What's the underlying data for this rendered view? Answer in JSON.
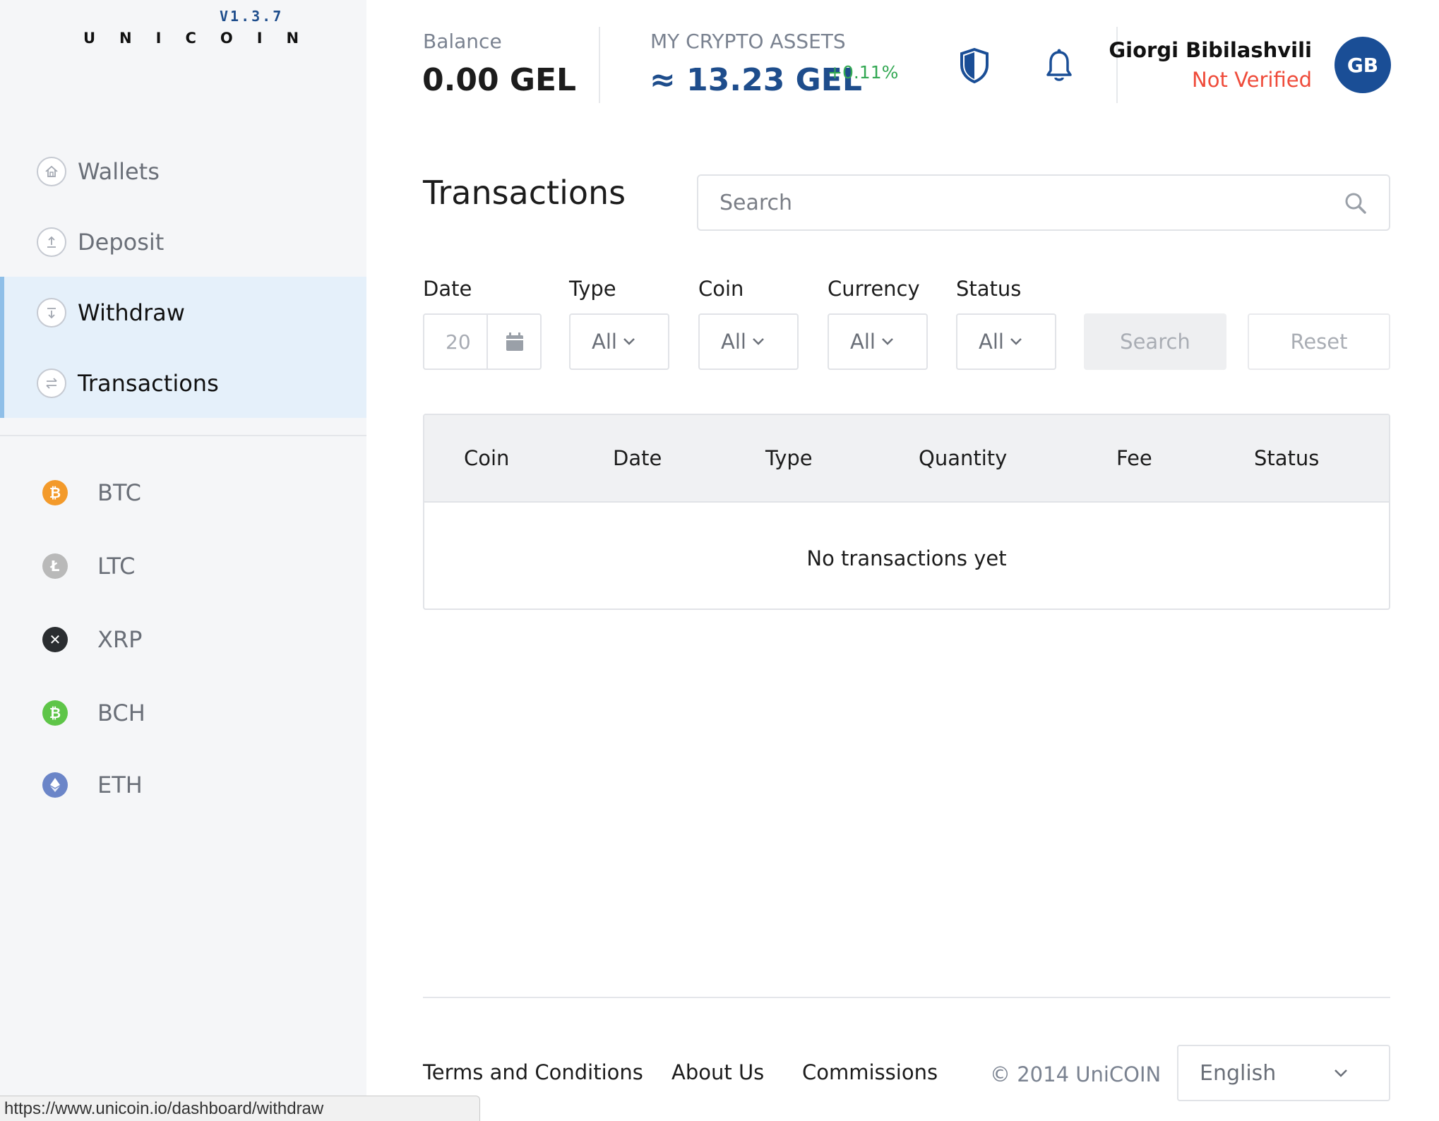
{
  "app": {
    "brand": "UNICOIN",
    "version": "V1.3.7"
  },
  "sidebar": {
    "nav": [
      {
        "label": "Wallets",
        "icon": "home-icon"
      },
      {
        "label": "Deposit",
        "icon": "upload-icon"
      },
      {
        "label": "Withdraw",
        "icon": "download-icon",
        "active": true
      },
      {
        "label": "Transactions",
        "icon": "exchange-icon",
        "active": true
      }
    ],
    "coins": [
      {
        "label": "BTC",
        "icon": "bitcoin-icon",
        "color": "#f39a2b"
      },
      {
        "label": "LTC",
        "icon": "litecoin-icon",
        "color": "#b9b9b9"
      },
      {
        "label": "XRP",
        "icon": "ripple-icon",
        "color": "#2a2d30"
      },
      {
        "label": "BCH",
        "icon": "bitcoin-cash-icon",
        "color": "#5ec548"
      },
      {
        "label": "ETH",
        "icon": "ethereum-icon",
        "color": "#6b85c8"
      }
    ]
  },
  "header": {
    "balance_label": "Balance",
    "balance_value": "0.00 GEL",
    "assets_label": "MY CRYPTO ASSETS",
    "assets_value": "≈ 13.23 GEL",
    "assets_change": "+0.11%",
    "user_name": "Giorgi Bibilashvili",
    "user_status": "Not Verified",
    "avatar_initials": "GB"
  },
  "main": {
    "title": "Transactions",
    "search_placeholder": "Search",
    "filters": {
      "date_label": "Date",
      "date_value": "20",
      "type_label": "Type",
      "type_value": "All",
      "coin_label": "Coin",
      "coin_value": "All",
      "currency_label": "Currency",
      "currency_value": "All",
      "status_label": "Status",
      "status_value": "All",
      "search_button": "Search",
      "reset_button": "Reset"
    },
    "table": {
      "columns": [
        "Coin",
        "Date",
        "Type",
        "Quantity",
        "Fee",
        "Status"
      ],
      "empty_message": "No transactions yet"
    }
  },
  "footer": {
    "links": [
      "Terms and Conditions",
      "About Us",
      "Commissions"
    ],
    "copyright": "© 2014 UniCOIN",
    "language": "English"
  },
  "status_bar": {
    "url": "https://www.unicoin.io/dashboard/withdraw"
  },
  "colors": {
    "brand_blue": "#1e4d8c",
    "positive_green": "#33a853",
    "warning_red": "#ef4b3a",
    "active_nav_bg": "#e5f0fa"
  }
}
